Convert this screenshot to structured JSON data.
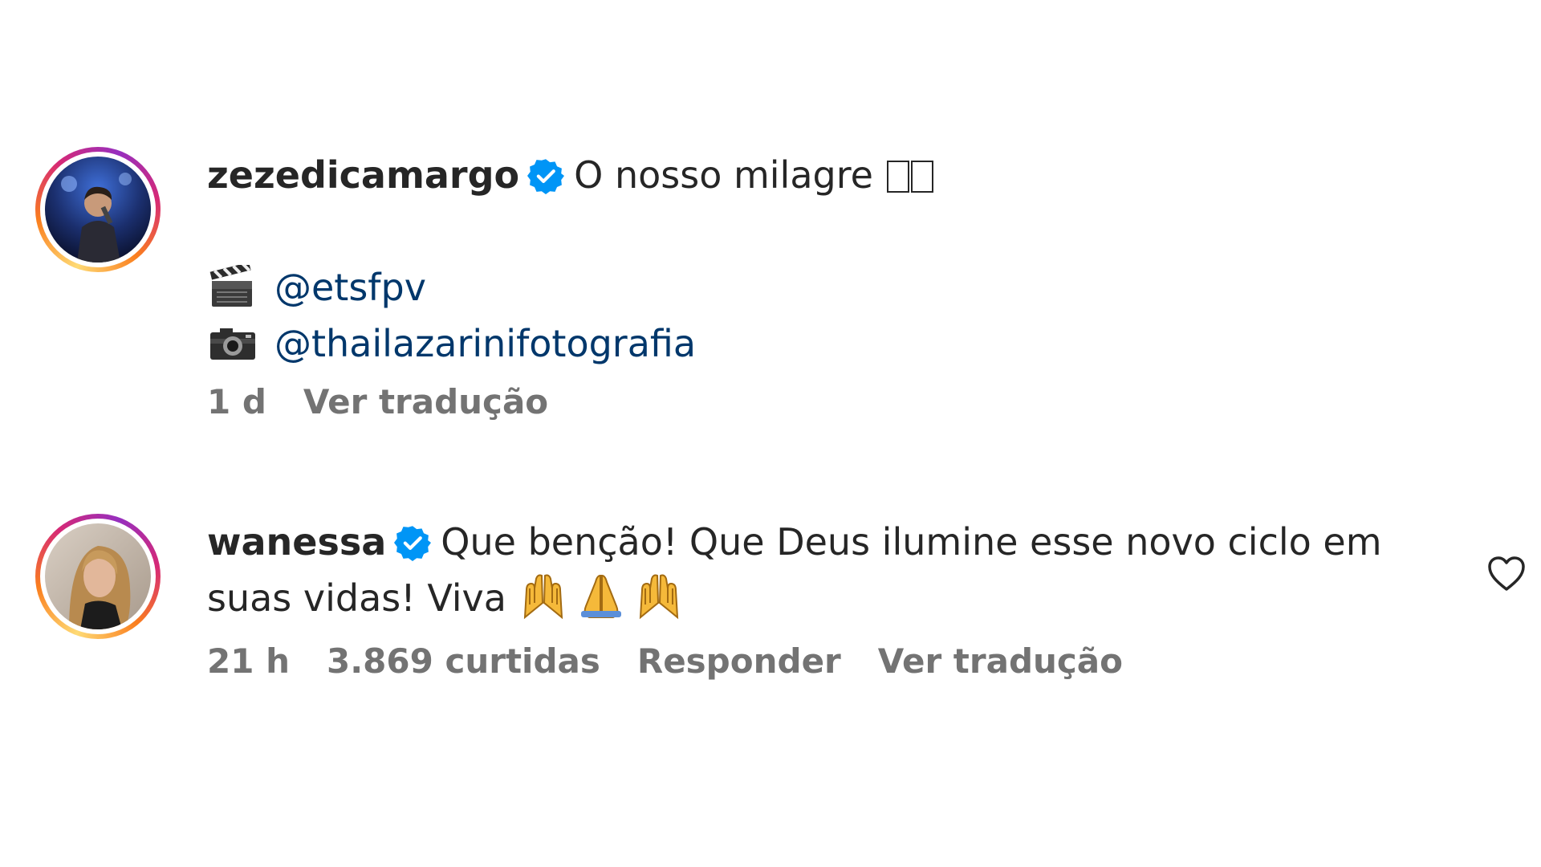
{
  "comments": [
    {
      "username": "zezedicamargo",
      "text": "O nosso milagre",
      "credits": [
        {
          "icon": "clapperboard-icon",
          "handle": "@etsfpv"
        },
        {
          "icon": "camera-icon",
          "handle": "@thailazarinifotografia"
        }
      ],
      "time": "1 d",
      "translate_label": "Ver tradução"
    },
    {
      "username": "wanessa",
      "text_line1": "Que benção! Que Deus ilumine esse novo ciclo em",
      "text_line2": "suas vidas! Viva",
      "emojis": [
        "raising-hands-icon",
        "folded-hands-icon",
        "raising-hands-icon"
      ],
      "time": "21 h",
      "likes": "3.869 curtidas",
      "reply_label": "Responder",
      "translate_label": "Ver tradução"
    }
  ],
  "colors": {
    "verified": "#0095f6",
    "mention": "#00376b",
    "meta": "#737373"
  }
}
